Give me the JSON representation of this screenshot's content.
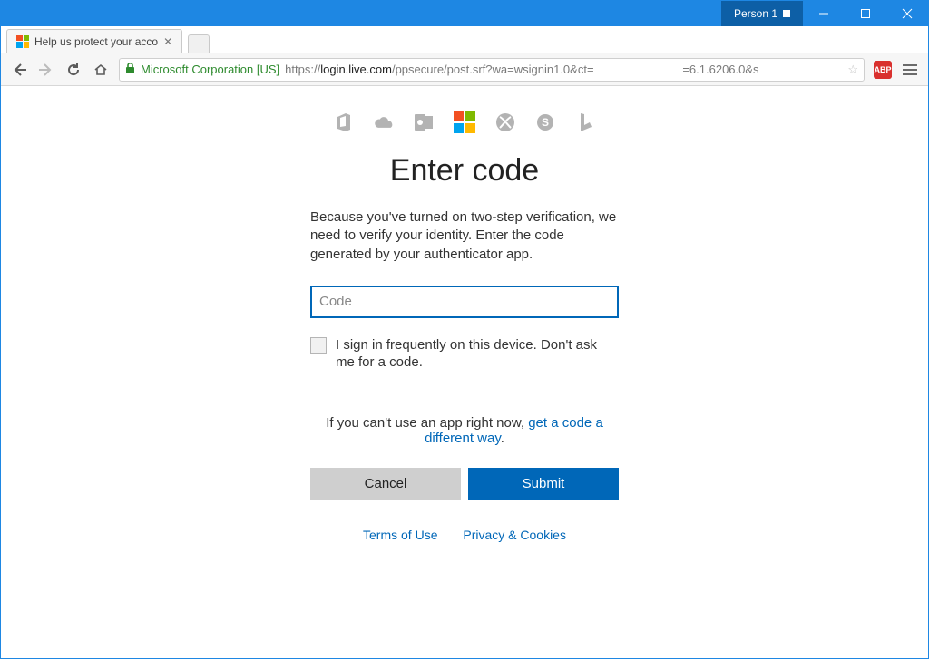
{
  "titlebar": {
    "profile_label": "Person 1"
  },
  "tab": {
    "title": "Help us protect your acco"
  },
  "addressbar": {
    "ev_label": "Microsoft Corporation [US]",
    "url_prefix": "https://",
    "url_host": "login.live.com",
    "url_path": "/ppsecure/post.srf?wa=wsignin1.0&ct=",
    "url_suffix": "=6.1.6206.0&s"
  },
  "extensions": {
    "abp_label": "ABP"
  },
  "page": {
    "heading": "Enter code",
    "description": "Because you've turned on two-step verification, we need to verify your identity. Enter the code generated by your authenticator app.",
    "code_placeholder": "Code",
    "remember_label": "I sign in frequently on this device. Don't ask me for a code.",
    "help_prefix": "If you can't use an app right now, ",
    "help_link": "get a code a different way",
    "help_suffix": ".",
    "cancel_label": "Cancel",
    "submit_label": "Submit",
    "terms_label": "Terms of Use",
    "privacy_label": "Privacy & Cookies"
  }
}
